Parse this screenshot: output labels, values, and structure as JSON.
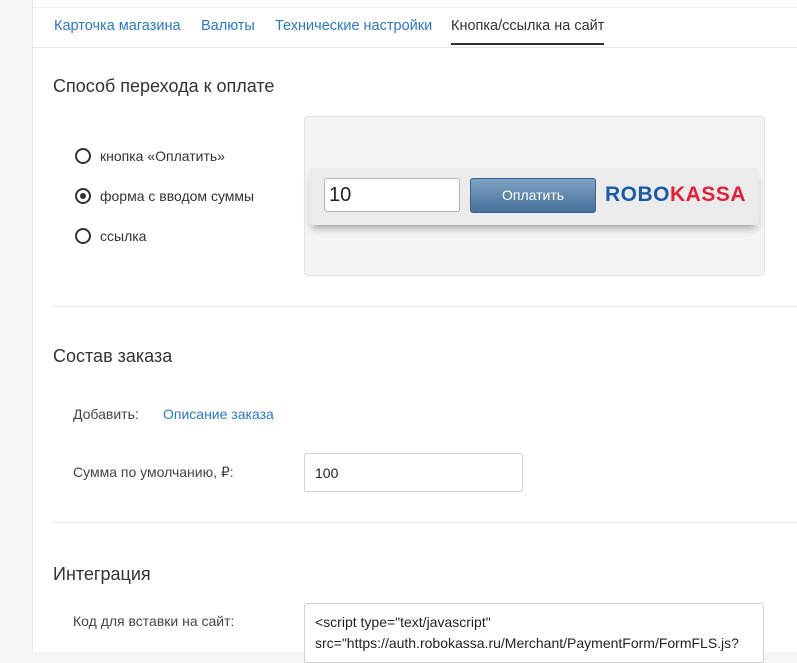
{
  "tabs": [
    {
      "label": "Карточка магазина"
    },
    {
      "label": "Валюты"
    },
    {
      "label": "Технические настройки"
    },
    {
      "label": "Кнопка/ссылка на сайт",
      "active": true
    }
  ],
  "payment_method": {
    "title": "Способ перехода к оплате",
    "options": [
      {
        "label": "кнопка «Оплатить»",
        "checked": false
      },
      {
        "label": "форма с вводом суммы",
        "checked": true
      },
      {
        "label": "ссылка",
        "checked": false
      }
    ],
    "preview": {
      "amount": "10",
      "button_label": "Оплатить",
      "logo_part1": "ROBO",
      "logo_part2": "KASSA"
    }
  },
  "order": {
    "title": "Состав заказа",
    "add_label": "Добавить:",
    "add_link": "Описание заказа",
    "default_sum_label": "Сумма по умолчанию, ₽:",
    "default_sum_value": "100"
  },
  "integration": {
    "title": "Интеграция",
    "code_label": "Код для вставки на сайт:",
    "code_lines": [
      "<script type=\"text/javascript\"",
      "src=\"https://auth.robokassa.ru/Merchant/PaymentForm/FormFLS.js?"
    ]
  },
  "colors": {
    "link": "#2b78c5",
    "logo_blue": "#1c5aa8",
    "logo_red": "#e2203a"
  }
}
